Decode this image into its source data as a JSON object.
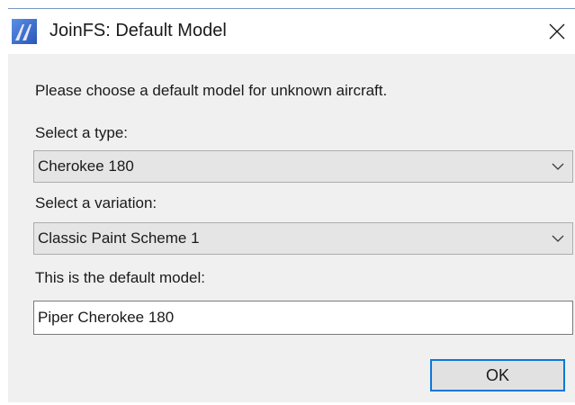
{
  "window": {
    "title": "JoinFS: Default Model",
    "app_icon": "joinfs-app-icon",
    "close_icon": "close-icon"
  },
  "dialog": {
    "instruction": "Please choose a default model for unknown aircraft.",
    "type_label": "Select a type:",
    "type_selected": "Cherokee 180",
    "variation_label": "Select a variation:",
    "variation_selected": "Classic Paint Scheme 1",
    "model_label": "This is the default model:",
    "model_value": "Piper Cherokee 180",
    "ok_label": "OK"
  },
  "colors": {
    "accent": "#0a78d7",
    "icon_blue": "#3a6fd8"
  }
}
